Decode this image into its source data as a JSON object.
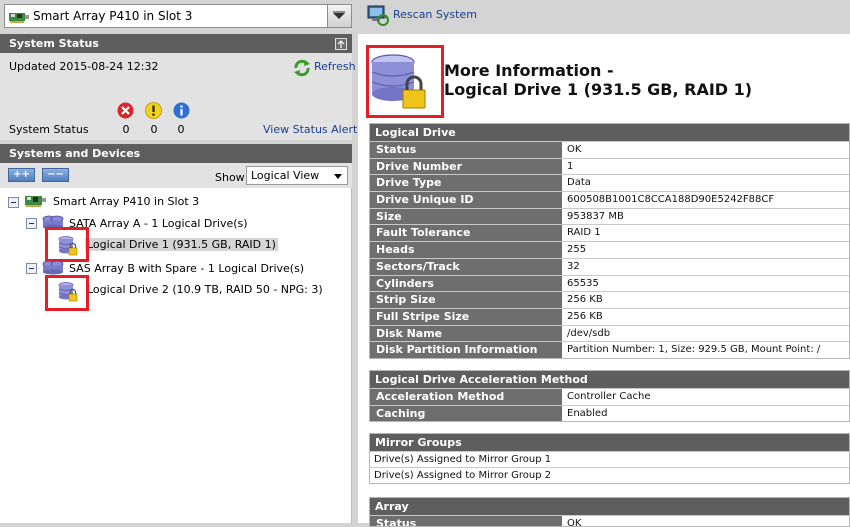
{
  "controller_select": {
    "value": "Smart Array P410 in Slot 3"
  },
  "toolbar": {
    "rescan_label": "Rescan System"
  },
  "system_status": {
    "header": "System Status",
    "updated": "Updated 2015-08-24 12:32",
    "refresh_label": "Refresh",
    "label": "System Status",
    "counts": {
      "critical": "0",
      "warning": "0",
      "info": "0"
    },
    "view_alerts": "View Status Alerts"
  },
  "systems_devices": {
    "header": "Systems and Devices",
    "expand_label": "++",
    "collapse_label": "−−",
    "show_label": "Show",
    "view_value": "Logical View"
  },
  "tree": {
    "controller": "Smart Array P410 in Slot 3",
    "array_a": "SATA Array A - 1 Logical Drive(s)",
    "ld1": "Logical Drive 1 (931.5 GB, RAID 1)",
    "array_b": "SAS Array B with Spare - 1 Logical Drive(s)",
    "ld2": "Logical Drive 2 (10.9 TB, RAID 50 - NPG: 3)"
  },
  "detail": {
    "title_line1": "More Information -",
    "title_line2": "Logical Drive 1 (931.5 GB, RAID 1)",
    "logical_drive": {
      "header": "Logical Drive",
      "rows": [
        {
          "k": "Status",
          "v": "OK"
        },
        {
          "k": "Drive Number",
          "v": "1"
        },
        {
          "k": "Drive Type",
          "v": "Data"
        },
        {
          "k": "Drive Unique ID",
          "v": "600508B1001C8CCA188D90E5242F88CF"
        },
        {
          "k": "Size",
          "v": "953837 MB"
        },
        {
          "k": "Fault Tolerance",
          "v": "RAID 1"
        },
        {
          "k": "Heads",
          "v": "255"
        },
        {
          "k": "Sectors/Track",
          "v": "32"
        },
        {
          "k": "Cylinders",
          "v": "65535"
        },
        {
          "k": "Strip Size",
          "v": "256 KB"
        },
        {
          "k": "Full Stripe Size",
          "v": "256 KB"
        },
        {
          "k": "Disk Name",
          "v": "/dev/sdb"
        },
        {
          "k": "Disk Partition Information",
          "v": "Partition Number: 1, Size: 929.5 GB, Mount Point: /"
        }
      ]
    },
    "acceleration": {
      "header": "Logical Drive Acceleration Method",
      "rows": [
        {
          "k": "Acceleration Method",
          "v": "Controller Cache"
        },
        {
          "k": "Caching",
          "v": "Enabled"
        }
      ]
    },
    "mirror_groups": {
      "header": "Mirror Groups",
      "rows": [
        "Drive(s) Assigned to Mirror Group 1",
        "Drive(s) Assigned to Mirror Group 2"
      ]
    },
    "array": {
      "header": "Array",
      "rows": [
        {
          "k": "Status",
          "v": "OK"
        }
      ]
    }
  }
}
